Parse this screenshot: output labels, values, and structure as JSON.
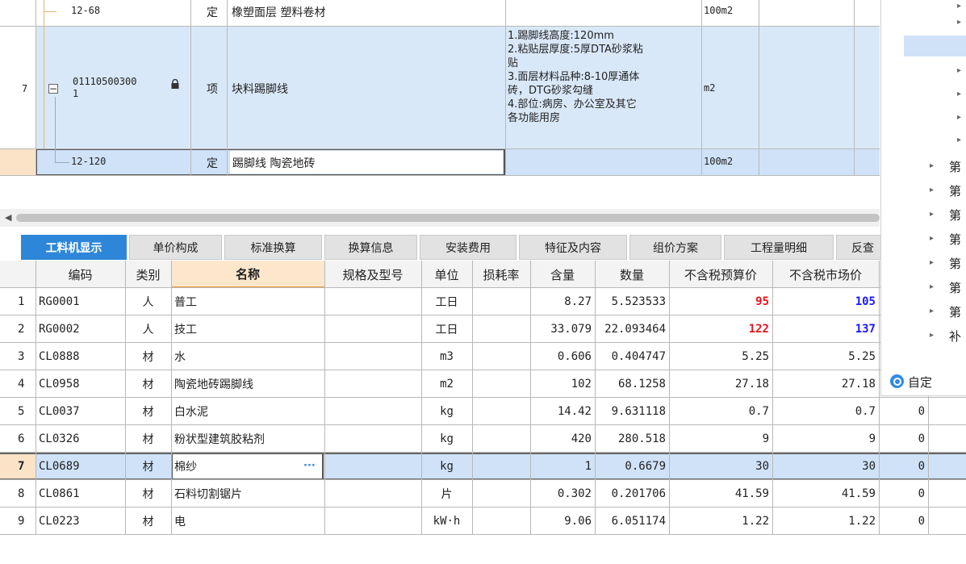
{
  "top_rows": [
    {
      "num": "",
      "code": "12-68",
      "type": "定",
      "name": "橡塑面层 塑料卷材",
      "feature_lines": [],
      "unit": "100m2"
    },
    {
      "num": "7",
      "code_line1": "01110500300",
      "code_line2": "1",
      "type": "项",
      "name": "块料踢脚线",
      "feature_lines": [
        "1.踢脚线高度:120mm",
        "2.粘贴层厚度:5厚DTA砂浆粘",
        "贴",
        "3.面层材料品种:8-10厚通体",
        "砖，DTG砂浆勾缝",
        "4.部位:病房、办公室及其它",
        "各功能用房"
      ],
      "unit": "m2"
    },
    {
      "num": "",
      "code": "12-120",
      "type": "定",
      "name": "踢脚线 陶瓷地砖",
      "feature_lines": [],
      "unit": "100m2"
    }
  ],
  "tabs": [
    "工料机显示",
    "单价构成",
    "标准换算",
    "换算信息",
    "安装费用",
    "特征及内容",
    "组价方案",
    "工程量明细",
    "反查"
  ],
  "columns": [
    "编码",
    "类别",
    "名称",
    "规格及型号",
    "单位",
    "损耗率",
    "含量",
    "数量",
    "不含税预算价",
    "不含税市场价"
  ],
  "rows": [
    {
      "n": "1",
      "code": "RG0001",
      "cat": "人",
      "name": "普工",
      "spec": "",
      "unit": "工日",
      "loss": "",
      "content": "8.27",
      "qty": "5.523533",
      "budget": "95",
      "market": "105",
      "extra": ""
    },
    {
      "n": "2",
      "code": "RG0002",
      "cat": "人",
      "name": "技工",
      "spec": "",
      "unit": "工日",
      "loss": "",
      "content": "33.079",
      "qty": "22.093464",
      "budget": "122",
      "market": "137",
      "extra": ""
    },
    {
      "n": "3",
      "code": "CL0888",
      "cat": "材",
      "name": "水",
      "spec": "",
      "unit": "m3",
      "loss": "",
      "content": "0.606",
      "qty": "0.404747",
      "budget": "5.25",
      "market": "5.25",
      "extra": ""
    },
    {
      "n": "4",
      "code": "CL0958",
      "cat": "材",
      "name": "陶瓷地砖踢脚线",
      "spec": "",
      "unit": "m2",
      "loss": "",
      "content": "102",
      "qty": "68.1258",
      "budget": "27.18",
      "market": "27.18",
      "extra": ""
    },
    {
      "n": "5",
      "code": "CL0037",
      "cat": "材",
      "name": "白水泥",
      "spec": "",
      "unit": "kg",
      "loss": "",
      "content": "14.42",
      "qty": "9.631118",
      "budget": "0.7",
      "market": "0.7",
      "extra": "0"
    },
    {
      "n": "6",
      "code": "CL0326",
      "cat": "材",
      "name": "粉状型建筑胶粘剂",
      "spec": "",
      "unit": "kg",
      "loss": "",
      "content": "420",
      "qty": "280.518",
      "budget": "9",
      "market": "9",
      "extra": "0"
    },
    {
      "n": "7",
      "code": "CL0689",
      "cat": "材",
      "name": "棉纱",
      "spec": "",
      "unit": "kg",
      "loss": "",
      "content": "1",
      "qty": "0.6679",
      "budget": "30",
      "market": "30",
      "extra": "0"
    },
    {
      "n": "8",
      "code": "CL0861",
      "cat": "材",
      "name": "石料切割锯片",
      "spec": "",
      "unit": "片",
      "loss": "",
      "content": "0.302",
      "qty": "0.201706",
      "budget": "41.59",
      "market": "41.59",
      "extra": "0"
    },
    {
      "n": "9",
      "code": "CL0223",
      "cat": "材",
      "name": "电",
      "spec": "",
      "unit": "kW·h",
      "loss": "",
      "content": "9.06",
      "qty": "6.051174",
      "budget": "1.22",
      "market": "1.22",
      "extra": "0"
    }
  ],
  "right_panel": {
    "categories": [
      "第",
      "第",
      "第",
      "第",
      "第",
      "第",
      "第",
      "补"
    ],
    "custom_label": "自定"
  },
  "colors": {
    "accent": "#2e86d8",
    "budget_red": "#e8141c",
    "market_blue": "#1a1aff",
    "selected_row": "#cfe2f8",
    "header_bg": "#f3f3f3"
  }
}
